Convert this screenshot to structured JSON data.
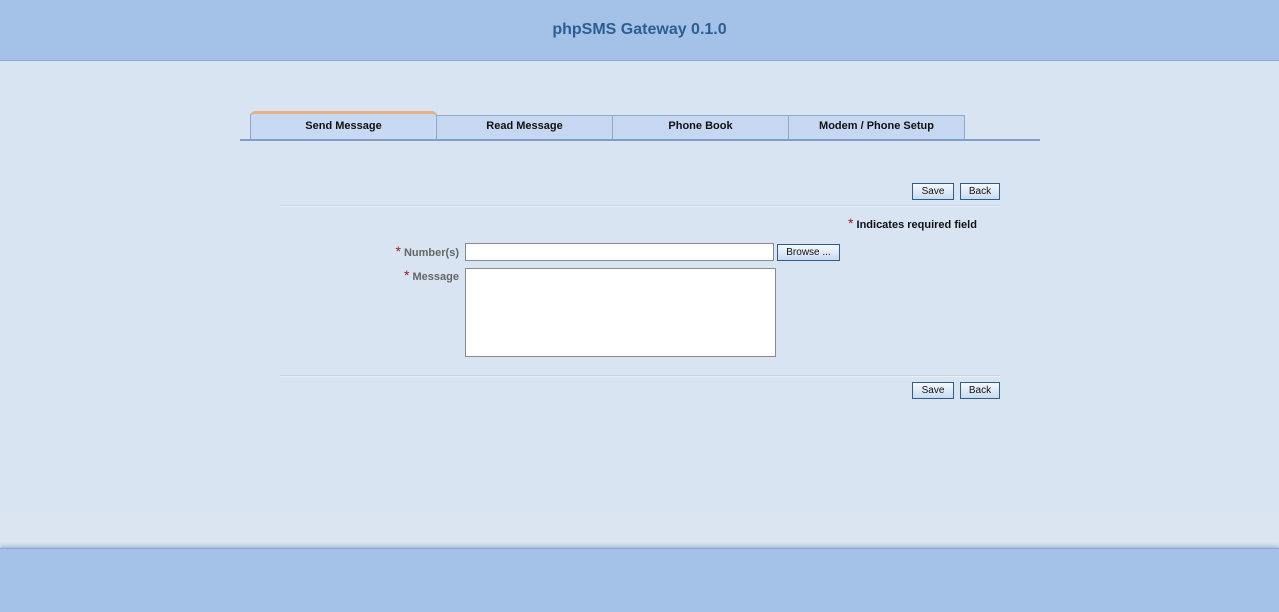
{
  "app": {
    "title": "phpSMS Gateway 0.1.0"
  },
  "tabs": [
    {
      "label": "Send Message",
      "active": true
    },
    {
      "label": "Read Message",
      "active": false
    },
    {
      "label": "Phone Book",
      "active": false
    },
    {
      "label": "Modem / Phone Setup",
      "active": false
    }
  ],
  "toolbar": {
    "save_label": "Save",
    "back_label": "Back"
  },
  "form": {
    "required_marker": "*",
    "required_note": "Indicates required field",
    "numbers_label": "Number(s)",
    "numbers_value": "",
    "browse_label": "Browse ...",
    "message_label": "Message",
    "message_value": ""
  },
  "colors": {
    "header_bg": "#a4c2e8",
    "title_color": "#2d5e91",
    "page_bg": "#d6e2ef",
    "active_tab_accent": "#e7b27f",
    "required_star": "#a21a1a"
  }
}
